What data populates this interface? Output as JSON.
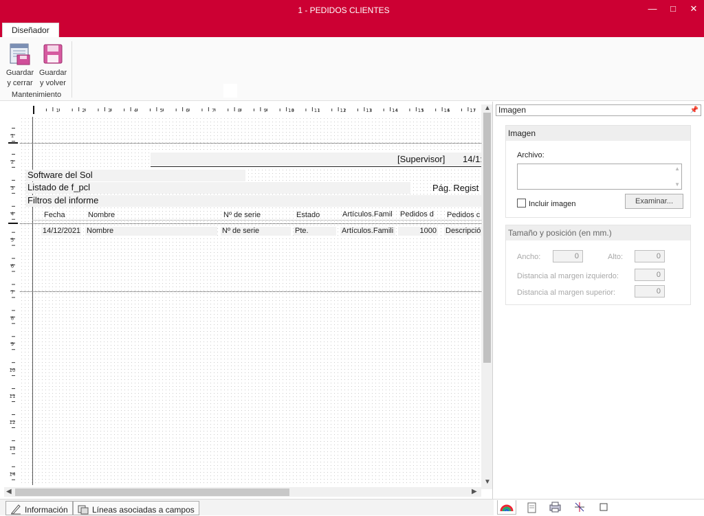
{
  "window": {
    "title": "1 - PEDIDOS CLIENTES",
    "minimize": "—",
    "maximize": "□",
    "close": "✕"
  },
  "ribbon": {
    "tab": "Diseñador",
    "save_close_line1": "Guardar",
    "save_close_line2": "y cerrar",
    "save_return_line1": "Guardar",
    "save_return_line2": "y volver",
    "group": "Mantenimiento"
  },
  "ruler": {
    "h_labels": [
      "1",
      "2",
      "3",
      "4",
      "5",
      "6",
      "7",
      "8",
      "9",
      "10",
      "11",
      "12",
      "13",
      "14",
      "15",
      "16",
      "17"
    ],
    "v_labels": [
      "1",
      "2",
      "3",
      "4",
      "5",
      "6",
      "7",
      "8",
      "9",
      "10",
      "11",
      "12",
      "13",
      "14"
    ]
  },
  "report": {
    "supervisor": "[Supervisor]",
    "date_header": "14/1:",
    "company": "Software del Sol",
    "listing": "Listado de f_pcl",
    "page": "Pág. Regist",
    "filters": "Filtros del informe",
    "columns": [
      "Fecha",
      "Nombre",
      "Nº de serie",
      "Estado",
      "Artículos.Famil",
      "Pedidos d",
      "Pedidos c"
    ],
    "row": [
      "14/12/2021",
      "Nombre",
      "Nº de serie",
      "Pte.",
      "Artículos.Famili",
      "1000",
      "Descripció"
    ]
  },
  "properties": {
    "selector": "Imagen",
    "image_group": "Imagen",
    "file_label": "Archivo:",
    "file_value": "",
    "include_image": "Incluir imagen",
    "browse_button": "Examinar...",
    "size_group": "Tamaño y posición (en mm.)",
    "width_label": "Ancho:",
    "width_value": "0",
    "height_label": "Alto:",
    "height_value": "0",
    "left_margin_label": "Distancia al margen izquierdo:",
    "left_margin_value": "0",
    "top_margin_label": "Distancia al margen superior:",
    "top_margin_value": "0"
  },
  "bottom_tabs": {
    "info": "Información",
    "lines": "Líneas asociadas a campos"
  },
  "colors": {
    "accent": "#cc0033"
  }
}
